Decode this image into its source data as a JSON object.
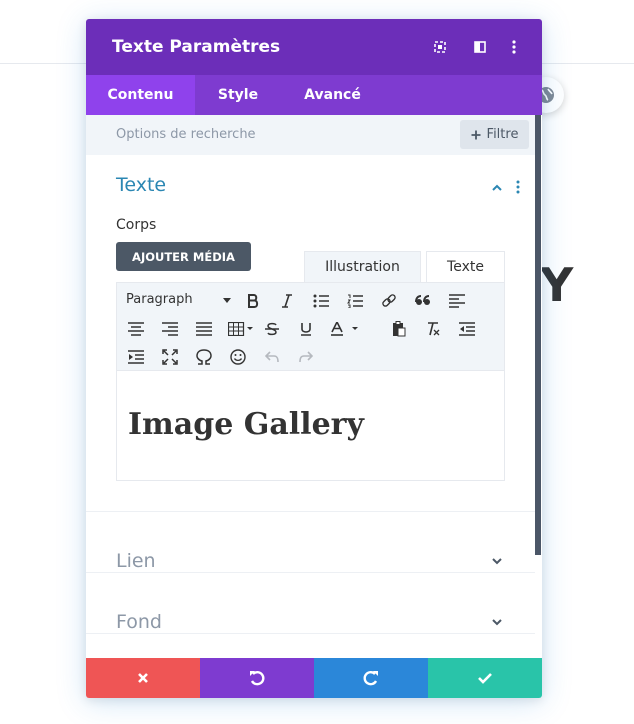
{
  "background": {
    "heading_partial": "Y"
  },
  "modal": {
    "title": "Texte Paramètres",
    "header_icons": [
      "focus-icon",
      "columns-icon",
      "more-vertical-icon"
    ],
    "tabs": [
      {
        "label": "Contenu",
        "active": true
      },
      {
        "label": "Style",
        "active": false
      },
      {
        "label": "Avancé",
        "active": false
      }
    ],
    "search": {
      "placeholder": "Options de recherche",
      "filter_label": "Filtre"
    },
    "sections": {
      "text": {
        "title": "Texte",
        "field_label": "Corps",
        "add_media_label": "AJOUTER MÉDIA",
        "editor_tabs": {
          "visual": "Illustration",
          "text": "Texte"
        },
        "format_select": "Paragraph",
        "content_heading": "Image Gallery"
      },
      "link": {
        "title": "Lien"
      },
      "background": {
        "title": "Fond"
      }
    },
    "footer_buttons": [
      "close-icon",
      "undo-icon",
      "redo-icon",
      "check-icon"
    ]
  },
  "colors": {
    "header": "#6c2eb9",
    "tabs": "#7e3bd0",
    "active_tab": "#8f42ec",
    "accent_title": "#2b87b3",
    "cancel": "#ef5555",
    "undo": "#7e3bd0",
    "redo": "#2b87d9",
    "save": "#29c4a9"
  }
}
